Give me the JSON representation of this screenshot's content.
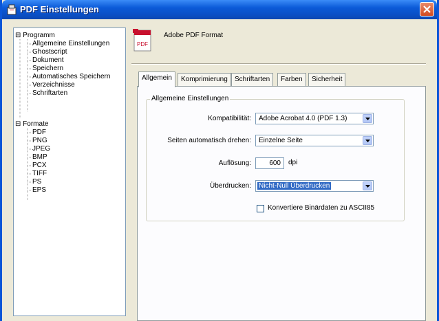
{
  "window": {
    "title": "PDF Einstellungen"
  },
  "tree": {
    "groups": [
      {
        "label": "Programm",
        "expander": "⊟",
        "items": [
          "Allgemeine Einstellungen",
          "Ghostscript",
          "Dokument",
          "Speichern",
          "Automatisches Speichern",
          "Verzeichnisse",
          "Schriftarten"
        ]
      },
      {
        "label": "Formate",
        "expander": "⊟",
        "items": [
          "PDF",
          "PNG",
          "JPEG",
          "BMP",
          "PCX",
          "TIFF",
          "PS",
          "EPS"
        ]
      }
    ]
  },
  "header": {
    "title": "Adobe PDF Format",
    "icon_label": "PDF"
  },
  "tabs": [
    "Allgemein",
    "Komprimierung",
    "Schriftarten",
    "Farben",
    "Sicherheit"
  ],
  "general": {
    "group_title": "Allgemeine Einstellungen",
    "compat_label": "Kompatibilität:",
    "compat_value": "Adobe Acrobat 4.0 (PDF 1.3)",
    "rotate_label": "Seiten automatisch drehen:",
    "rotate_value": "Einzelne Seite",
    "resolution_label": "Auflösung:",
    "resolution_value": "600",
    "resolution_unit": "dpi",
    "overprint_label": "Überdrucken:",
    "overprint_value": "Nicht-Null Überdrucken",
    "ascii_label": "Konvertiere Binärdaten zu ASCII85",
    "ascii_checked": false
  },
  "colors": {
    "titlebar": "#0a56d8",
    "selection": "#316ac5",
    "face": "#ece9d8"
  }
}
